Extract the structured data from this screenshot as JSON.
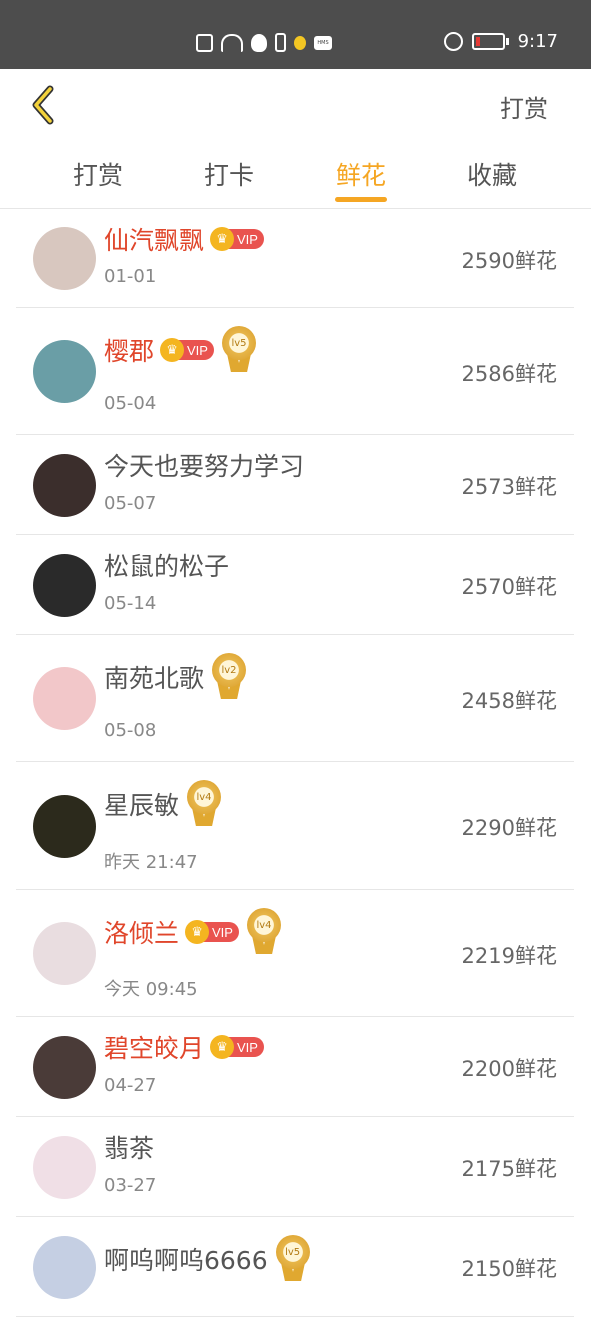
{
  "status_bar": {
    "time": "9:17",
    "icons": [
      "sim-alert-icon",
      "wifi-icon",
      "qq-icon",
      "phone-icon",
      "bulb-icon",
      "hms-icon",
      "alarm-icon",
      "battery-icon"
    ],
    "hms_text": "HMS",
    "battery_level": 0.1
  },
  "header": {
    "back_icon": "chevron-left-icon",
    "action_label": "打赏"
  },
  "tabs": [
    {
      "label": "打赏",
      "active": false
    },
    {
      "label": "打卡",
      "active": false
    },
    {
      "label": "鲜花",
      "active": true
    },
    {
      "label": "收藏",
      "active": false
    }
  ],
  "colors": {
    "accent": "#f5a623",
    "vip_name": "#e0462b",
    "status_bar": "#4d4d4d"
  },
  "badges": {
    "vip_label": "VIP",
    "crown_glyph": "♛"
  },
  "rows": [
    {
      "name": "仙汽飘飘",
      "vip": true,
      "level": "",
      "date": "01-01",
      "amount": "2590鲜花",
      "avatar_color": "#d8c7bf"
    },
    {
      "name": "樱郡",
      "vip": true,
      "level": "lv5",
      "date": "05-04",
      "amount": "2586鲜花",
      "avatar_color": "#6a9ea6"
    },
    {
      "name": "今天也要努力学习",
      "vip": false,
      "level": "",
      "date": "05-07",
      "amount": "2573鲜花",
      "avatar_color": "#3b2e2c"
    },
    {
      "name": "松鼠的松子",
      "vip": false,
      "level": "",
      "date": "05-14",
      "amount": "2570鲜花",
      "avatar_color": "#2a2a2a"
    },
    {
      "name": "南苑北歌",
      "vip": false,
      "level": "lv2",
      "date": "05-08",
      "amount": "2458鲜花",
      "avatar_color": "#f2c7c9"
    },
    {
      "name": "星辰敏",
      "vip": false,
      "level": "lv4",
      "date": "昨天 21:47",
      "amount": "2290鲜花",
      "avatar_color": "#2c2a1c"
    },
    {
      "name": "洛倾兰",
      "vip": true,
      "level": "lv4",
      "date": "今天 09:45",
      "amount": "2219鲜花",
      "avatar_color": "#e9dde0"
    },
    {
      "name": "碧空皎月",
      "vip": true,
      "level": "",
      "date": "04-27",
      "amount": "2200鲜花",
      "avatar_color": "#4a3b38"
    },
    {
      "name": "翡茶",
      "vip": false,
      "level": "",
      "date": "03-27",
      "amount": "2175鲜花",
      "avatar_color": "#f0dfe6"
    },
    {
      "name": "啊呜啊呜6666",
      "vip": false,
      "level": "lv5",
      "date": "",
      "amount": "2150鲜花",
      "avatar_color": "#c5cfe3"
    }
  ]
}
